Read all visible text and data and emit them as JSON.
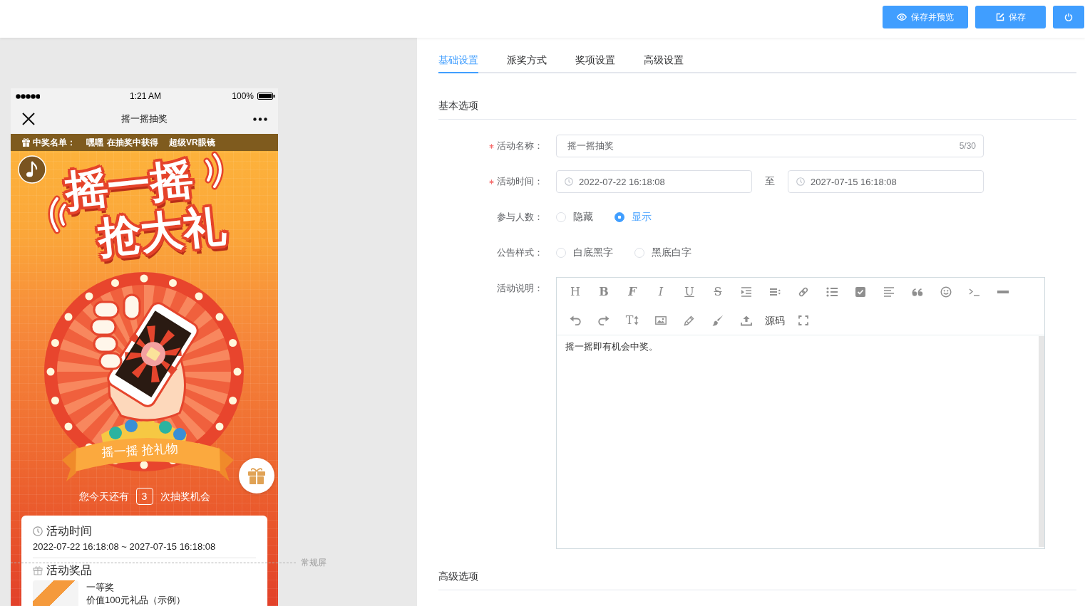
{
  "actions": [
    {
      "kind": "preview",
      "label": "保存并预览"
    },
    {
      "kind": "save",
      "label": "保存"
    },
    {
      "kind": "power"
    }
  ],
  "preview": {
    "status_bar": {
      "time": "1:21 AM",
      "battery": "100%"
    },
    "nav_bar": {
      "title": "摇一摇抽奖"
    },
    "winners": {
      "label": "中奖名单：",
      "entries": [
        {
          "name": "嘿嘿",
          "action": "在抽奖中获得",
          "prize": "超级VR眼镜"
        }
      ]
    },
    "banner": {
      "title_lines": [
        "摇一摇",
        "抢大礼"
      ],
      "ribbon": "摇一摇 抢礼物"
    },
    "chances": {
      "before": "您今天还有",
      "count": "3",
      "after": "次抽奖机会"
    },
    "card": {
      "sections": [
        {
          "kind": "time",
          "title": "活动时间",
          "text": "2022-07-22 16:18:08 ~ 2027-07-15 16:18:08"
        },
        {
          "kind": "prizes",
          "title": "活动奖品",
          "prizes": [
            {
              "name": "一等奖",
              "description": "价值100元礼品（示例）"
            }
          ]
        }
      ]
    }
  },
  "fold_guide": {
    "label": "常规屏"
  },
  "tabs": [
    {
      "label": "基础设置",
      "selected": true
    },
    {
      "label": "派奖方式",
      "selected": false
    },
    {
      "label": "奖项设置",
      "selected": false
    },
    {
      "label": "高级设置",
      "selected": false
    }
  ],
  "sections": [
    {
      "title": "基本选项",
      "fields": [
        {
          "kind": "text",
          "label": "活动名称：",
          "required": true,
          "value": "摇一摇抽奖",
          "counter": "5/30"
        },
        {
          "kind": "daterange",
          "label": "活动时间：",
          "required": true,
          "start": "2022-07-22 16:18:08",
          "separator": "至",
          "end": "2027-07-15 16:18:08"
        },
        {
          "kind": "radio",
          "label": "参与人数：",
          "required": false,
          "options": [
            {
              "label": "隐藏",
              "selected": false
            },
            {
              "label": "显示",
              "selected": true
            }
          ]
        },
        {
          "kind": "radio",
          "label": "公告样式：",
          "required": false,
          "options": [
            {
              "label": "白底黑字",
              "selected": false
            },
            {
              "label": "黑底白字",
              "selected": false
            }
          ]
        },
        {
          "kind": "editor",
          "label": "活动说明：",
          "required": false,
          "toolbar": [
            [
              {
                "kind": "heading",
                "label": "H"
              },
              {
                "kind": "bold",
                "label": "B"
              },
              {
                "kind": "font",
                "label": "F"
              },
              {
                "kind": "italic",
                "label": "I"
              },
              {
                "kind": "underline",
                "label": "U"
              },
              {
                "kind": "strike",
                "label": "S"
              },
              {
                "kind": "indent"
              },
              {
                "kind": "lineheight"
              },
              {
                "kind": "link"
              },
              {
                "kind": "list"
              },
              {
                "kind": "todo"
              },
              {
                "kind": "align"
              },
              {
                "kind": "quote"
              },
              {
                "kind": "emoji"
              },
              {
                "kind": "code"
              },
              {
                "kind": "rule"
              }
            ],
            [
              {
                "kind": "undo"
              },
              {
                "kind": "redo"
              },
              {
                "kind": "fontsize",
                "label": "T"
              },
              {
                "kind": "image"
              },
              {
                "kind": "eraser"
              },
              {
                "kind": "brush"
              },
              {
                "kind": "upload"
              },
              {
                "kind": "source",
                "label": "源码"
              },
              {
                "kind": "fullscreen"
              }
            ]
          ],
          "content": "摇一摇即有机会中奖。"
        }
      ]
    },
    {
      "title": "高级选项"
    }
  ]
}
